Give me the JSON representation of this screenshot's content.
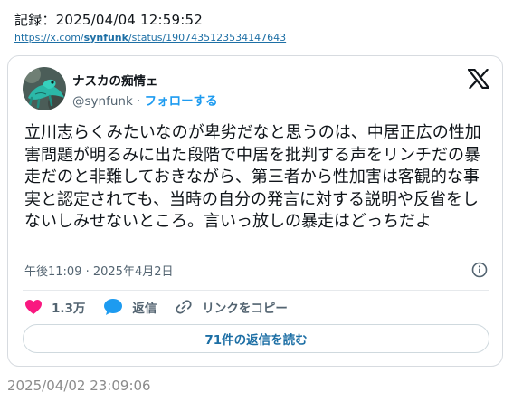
{
  "record": {
    "title": "記録：2025/04/04 12:59:52",
    "url_prefix": "https://x.com/",
    "url_user": "synfunk",
    "url_suffix": "/status/1907435123534147643"
  },
  "tweet": {
    "display_name": "ナスカの痴情ェ",
    "handle": "@synfunk",
    "separator": "·",
    "follow_label": "フォローする",
    "text": "立川志らくみたいなのが卑劣だなと思うのは、中居正広の性加害問題が明るみに出た段階で中居を批判する声をリンチだの暴走だのと非難しておきながら、第三者から性加害は客観的な事実と認定されても、当時の自分の発言に対する説明や反省をしないしみせないところ。言いっ放しの暴走はどっちだよ",
    "timestamp": "午後11:09 · 2025年4月2日",
    "likes": "1.3万",
    "reply_label": "返信",
    "copy_link_label": "リンクをコピー",
    "read_replies_label": "71件の返信を読む"
  },
  "icons": {
    "brand": "x-logo-icon",
    "info": "info-icon",
    "like": "heart-icon",
    "reply": "speech-bubble-icon",
    "link": "link-icon"
  },
  "colors": {
    "link_blue": "#1d6fa5",
    "follow_blue": "#1d9bf0",
    "heart_pink": "#f91880",
    "reply_blue": "#1d9bf0",
    "muted_text": "#536471"
  },
  "footer": {
    "date": "2025/04/02 23:09:06"
  }
}
